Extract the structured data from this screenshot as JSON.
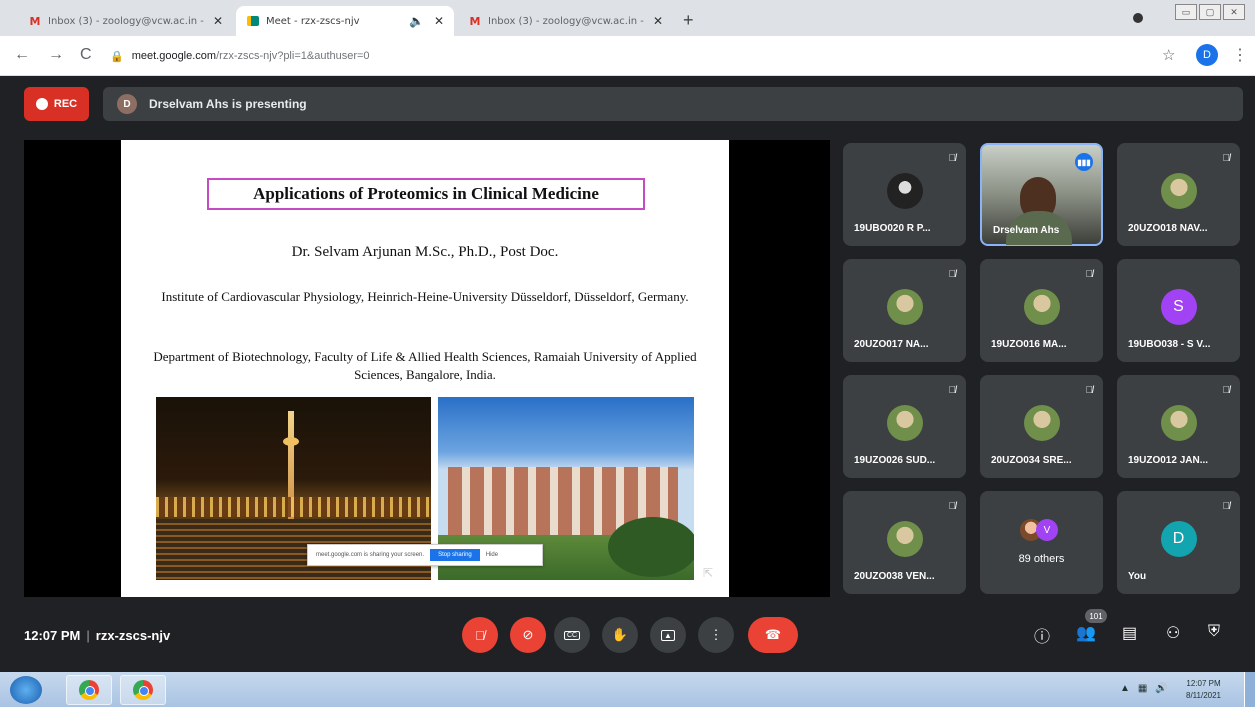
{
  "browser": {
    "tabs": [
      {
        "label": "Inbox (3) - zoology@vcw.ac.in -",
        "favicon": "M"
      },
      {
        "label": "Meet - rzx-zscs-njv",
        "favicon": "meet"
      },
      {
        "label": "Inbox (3) - zoology@vcw.ac.in -",
        "favicon": "M"
      }
    ],
    "url_host": "meet.google.com",
    "url_path": "/rzx-zscs-njv?pli=1&authuser=0",
    "profile_initial": "D"
  },
  "meet": {
    "rec_label": "REC",
    "presenter_initial": "D",
    "presenting_text": "Drselvam Ahs is presenting",
    "meeting_time": "12:07 PM",
    "meeting_code": "rzx-zscs-njv",
    "participant_count": "101"
  },
  "slide": {
    "title": "Applications of Proteomics in Clinical Medicine",
    "author": "Dr. Selvam Arjunan M.Sc., Ph.D., Post Doc.",
    "affiliation1": "Institute of Cardiovascular Physiology, Heinrich-Heine-University Düsseldorf, Düsseldorf, Germany.",
    "affiliation2": "Department of Biotechnology, Faculty of Life & Allied Health Sciences, Ramaiah University of Applied Sciences, Bangalore, India.",
    "share_notice": "meet.google.com is sharing your screen.",
    "stop_sharing": "Stop sharing",
    "hide": "Hide"
  },
  "participants": [
    {
      "name": "19UBO020 R P...",
      "avatar": "photo-dark"
    },
    {
      "name": "Drselvam Ahs",
      "avatar": "video"
    },
    {
      "name": "20UZO018 NAV...",
      "avatar": "photo"
    },
    {
      "name": "20UZO017 NA...",
      "avatar": "photo"
    },
    {
      "name": "19UZO016 MA...",
      "avatar": "photo"
    },
    {
      "name": "19UBO038 - S V...",
      "avatar": "letter",
      "letter": "S",
      "color": "#a142f4"
    },
    {
      "name": "19UZO026 SUD...",
      "avatar": "photo"
    },
    {
      "name": "20UZO034 SRE...",
      "avatar": "photo"
    },
    {
      "name": "19UZO012 JAN...",
      "avatar": "photo"
    },
    {
      "name": "20UZO038 VEN...",
      "avatar": "photo"
    },
    {
      "name": "89 others",
      "avatar": "group",
      "letter": "V",
      "color": "#a142f4"
    },
    {
      "name": "You",
      "avatar": "letter",
      "letter": "D",
      "color": "#12a4af"
    }
  ],
  "taskbar": {
    "time": "12:07 PM",
    "date": "8/11/2021"
  },
  "colors": {
    "meet_bg": "#202124",
    "tile_bg": "#3c4043",
    "rec_red": "#d93025",
    "control_red": "#ea4335"
  }
}
